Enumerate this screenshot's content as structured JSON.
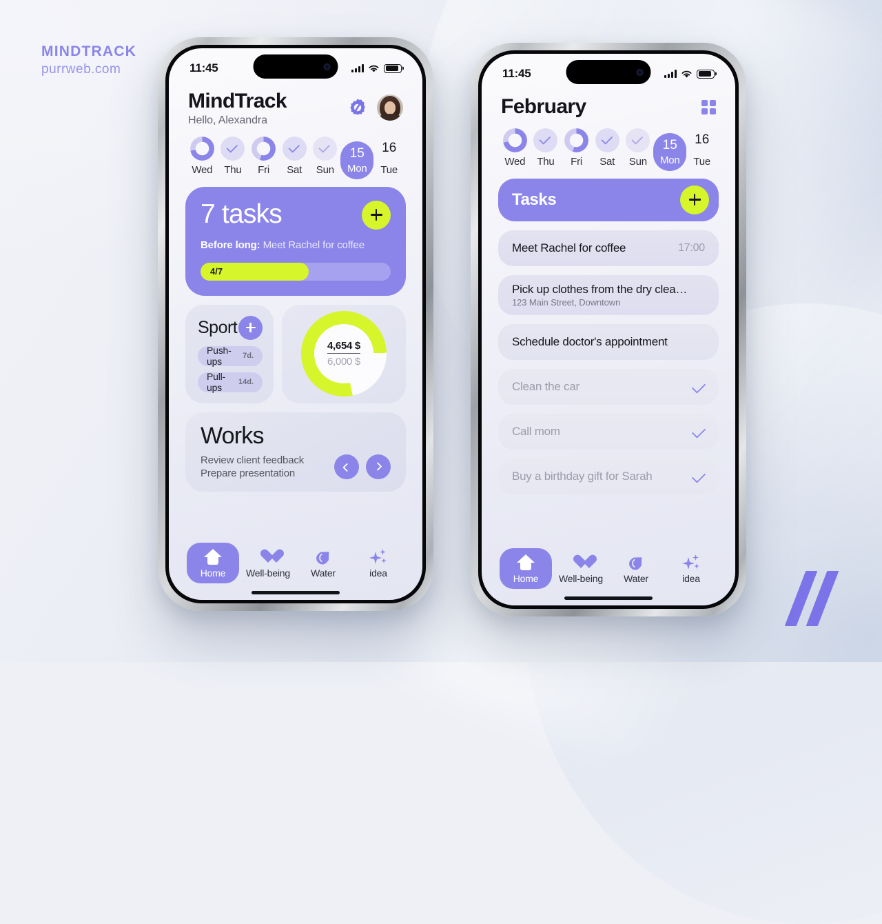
{
  "branding": {
    "name": "MINDTRACK",
    "website": "purrweb.com",
    "logo_icon": "double-slash-logo"
  },
  "colors": {
    "accent_purple": "#8b85ea",
    "accent_lime": "#d6f52a",
    "card_grey": "#e4e5f1",
    "text_dark": "#15161b",
    "text_muted": "#76778a"
  },
  "phone_left": {
    "status_bar": {
      "time": "11:45",
      "signal_icon": "cellular-signal-icon",
      "wifi_icon": "wifi-icon",
      "battery_icon": "battery-icon"
    },
    "header": {
      "title": "MindTrack",
      "greeting": "Hello, Alexandra",
      "settings_icon": "gear-slash-icon",
      "avatar_icon": "user-avatar"
    },
    "days": [
      {
        "label": "Wed",
        "state": "ring",
        "progress": 72
      },
      {
        "label": "Thu",
        "state": "check"
      },
      {
        "label": "Fri",
        "state": "ring",
        "progress": 55
      },
      {
        "label": "Sat",
        "state": "check"
      },
      {
        "label": "Sun",
        "state": "check-faint"
      },
      {
        "label": "Mon",
        "date": "15",
        "state": "selected"
      },
      {
        "label": "Tue",
        "date": "16",
        "state": "plain"
      }
    ],
    "hero": {
      "count": "7 tasks",
      "sub_prefix": "Before long:",
      "sub_text": "Meet Rachel for coffee",
      "progress_label": "4/7",
      "progress_percent": 57,
      "add_icon": "plus-icon"
    },
    "sport": {
      "title": "Sport",
      "add_icon": "plus-icon",
      "items": [
        {
          "name": "Push-ups",
          "meta": "7d."
        },
        {
          "name": "Pull-ups",
          "meta": "14d."
        }
      ]
    },
    "budget": {
      "current": "4,654 $",
      "goal": "6,000 $",
      "percent": 78
    },
    "works": {
      "title": "Works",
      "lines": [
        "Review client feedback",
        "Prepare presentation"
      ],
      "prev_icon": "chevron-left-icon",
      "next_icon": "chevron-right-icon"
    },
    "tabbar": [
      {
        "label": "Home",
        "icon": "home-icon",
        "active": true
      },
      {
        "label": "Well-being",
        "icon": "heart-icon",
        "active": false
      },
      {
        "label": "Water",
        "icon": "water-drop-icon",
        "active": false
      },
      {
        "label": "idea",
        "icon": "sparkles-icon",
        "active": false
      }
    ]
  },
  "phone_right": {
    "status_bar": {
      "time": "11:45",
      "signal_icon": "cellular-signal-icon",
      "wifi_icon": "wifi-icon",
      "battery_icon": "battery-icon"
    },
    "header": {
      "title": "February",
      "grid_icon": "grid-view-icon"
    },
    "days": [
      {
        "label": "Wed",
        "state": "ring",
        "progress": 72
      },
      {
        "label": "Thu",
        "state": "check"
      },
      {
        "label": "Fri",
        "state": "ring",
        "progress": 55
      },
      {
        "label": "Sat",
        "state": "check"
      },
      {
        "label": "Sun",
        "state": "check-faint"
      },
      {
        "label": "Mon",
        "date": "15",
        "state": "selected"
      },
      {
        "label": "Tue",
        "date": "16",
        "state": "plain"
      }
    ],
    "tasks_header": {
      "title": "Tasks",
      "add_icon": "plus-icon"
    },
    "tasks": [
      {
        "name": "Meet Rachel for coffee",
        "time": "17:00",
        "done": false
      },
      {
        "name": "Pick up clothes from the dry clea…",
        "sub": "123 Main Street, Downtown",
        "done": false
      },
      {
        "name": "Schedule doctor's appointment",
        "done": false
      },
      {
        "name": "Clean the car",
        "done": true,
        "check_icon": "check-icon"
      },
      {
        "name": "Call mom",
        "done": true,
        "check_icon": "check-icon"
      },
      {
        "name": "Buy a birthday gift for Sarah",
        "done": true,
        "check_icon": "check-icon"
      }
    ],
    "tabbar": [
      {
        "label": "Home",
        "icon": "home-icon",
        "active": true
      },
      {
        "label": "Well-being",
        "icon": "heart-icon",
        "active": false
      },
      {
        "label": "Water",
        "icon": "water-drop-icon",
        "active": false
      },
      {
        "label": "idea",
        "icon": "sparkles-icon",
        "active": false
      }
    ]
  }
}
